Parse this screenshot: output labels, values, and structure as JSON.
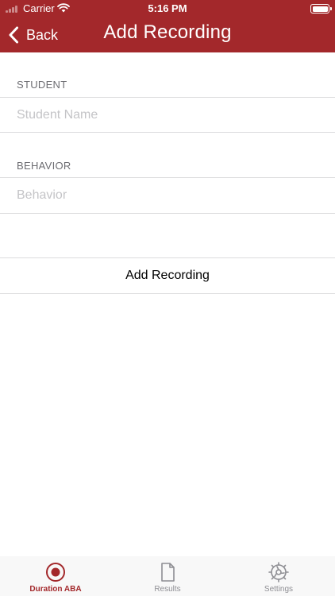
{
  "status_bar": {
    "carrier": "Carrier",
    "time": "5:16 PM"
  },
  "nav": {
    "back_label": "Back",
    "title": "Add Recording"
  },
  "form": {
    "student": {
      "header": "STUDENT",
      "placeholder": "Student Name",
      "value": ""
    },
    "behavior": {
      "header": "BEHAVIOR",
      "placeholder": "Behavior",
      "value": ""
    },
    "add_button_label": "Add Recording"
  },
  "tab_bar": {
    "tabs": [
      {
        "label": "Duration ABA",
        "icon": "record-icon",
        "active": true
      },
      {
        "label": "Results",
        "icon": "document-icon",
        "active": false
      },
      {
        "label": "Settings",
        "icon": "settings-gear-icon",
        "active": false
      }
    ]
  },
  "colors": {
    "brand": "#a3282b",
    "tab_inactive": "#8e8e93",
    "section_header": "#6d6d72",
    "placeholder": "#c4c4c7"
  }
}
